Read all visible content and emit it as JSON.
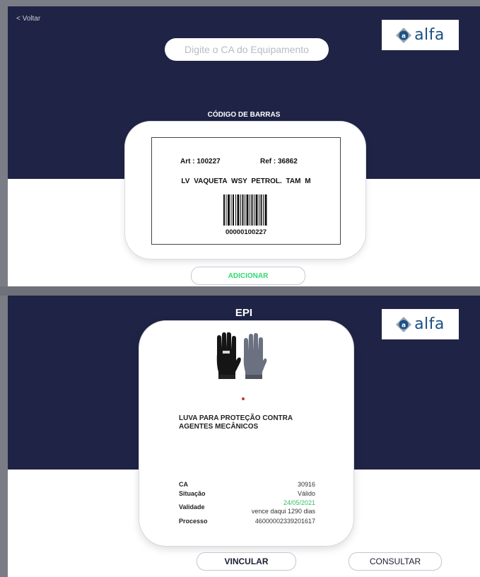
{
  "screen1": {
    "back_label": "< Voltar",
    "logo_text": "alfa",
    "logo_mark_letter": "a",
    "ca_input": {
      "placeholder": "Digite o CA do Equipamento",
      "value": ""
    },
    "barcode_title": "CÓDIGO DE BARRAS",
    "label": {
      "art": "Art : 100227",
      "ref": "Ref : 36862",
      "description": "LV VAQUETA WSY PETROL. TAM M",
      "barcode_number": "00000100227"
    },
    "add_button": "ADICIONAR"
  },
  "screen2": {
    "title": "EPI",
    "logo_text": "alfa",
    "logo_mark_letter": "a",
    "product_name": "LUVA PARA PROTEÇÃO CONTRA AGENTES MECÂNICOS",
    "details": {
      "ca_label": "CA",
      "ca_value": "30916",
      "situacao_label": "Situação",
      "situacao_value": "Válido",
      "validade_label": "Validade",
      "validade_date": "24/05/2021",
      "validade_note": "vence daqui 1290 dias",
      "processo_label": "Processo",
      "processo_value": "46000002339201617"
    },
    "vincular_button": "VINCULAR",
    "consultar_button": "CONSULTAR"
  },
  "colors": {
    "navy": "#1f2345",
    "add_green": "#2fd96d",
    "valid_green": "#2fbe62",
    "logo_blue": "#1c4f86"
  },
  "icons": {
    "logo": "alfa-logo-mark",
    "product": "gloves-image"
  }
}
